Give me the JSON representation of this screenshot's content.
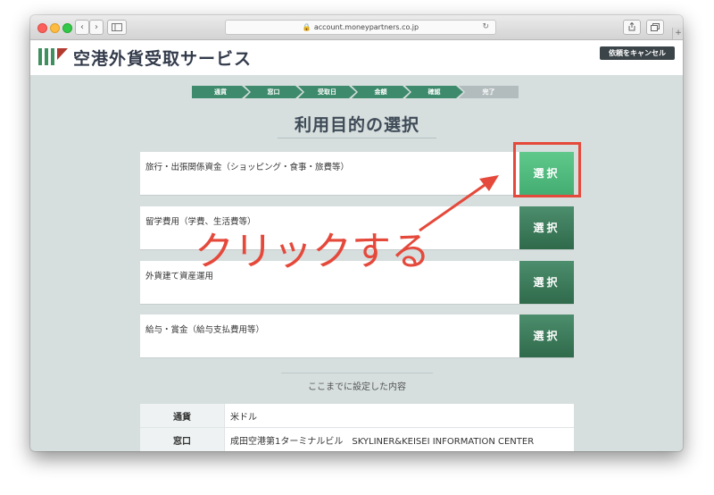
{
  "browser": {
    "url": "account.moneypartners.co.jp",
    "back_label": "‹",
    "forward_label": "›",
    "reload_label": "↻",
    "plus_label": "+"
  },
  "header": {
    "site_title": "空港外貨受取サービス",
    "cancel_label": "依頼をキャンセル"
  },
  "steps": [
    "通貨",
    "窓口",
    "受取日",
    "金額",
    "確認",
    "完了"
  ],
  "page_title": "利用目的の選択",
  "options": [
    {
      "label": "旅行・出張関係資金（ショッピング・食事・旅費等）",
      "button": "選択"
    },
    {
      "label": "留学費用（学費、生活費等）",
      "button": "選択"
    },
    {
      "label": "外貨建て資産運用",
      "button": "選択"
    },
    {
      "label": "給与・賞金（給与支払費用等）",
      "button": "選択"
    }
  ],
  "annotation": {
    "text": "クリックする",
    "color": "#e5493b"
  },
  "summary": {
    "title": "ここまでに設定した内容",
    "rows": [
      {
        "key": "通貨",
        "value": "米ドル"
      },
      {
        "key": "窓口",
        "value": "成田空港第1ターミナルビル　SKYLINER&KEISEI INFORMATION CENTER"
      }
    ]
  },
  "colors": {
    "step_active": "#3e8a6c",
    "step_inactive": "#b3bcbd",
    "button_green": "#2f6a4b",
    "button_highlight": "#44ad72",
    "accent_red": "#e5493b"
  }
}
